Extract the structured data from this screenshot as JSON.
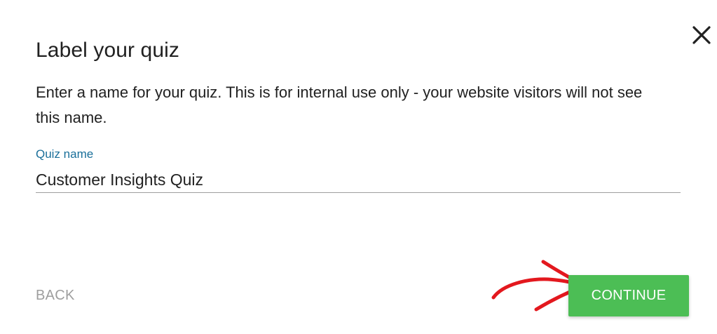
{
  "dialog": {
    "title": "Label your quiz",
    "description": "Enter a name for your quiz. This is for internal use only - your website visitors will not see this name.",
    "field": {
      "label": "Quiz name",
      "value": "Customer Insights Quiz",
      "placeholder": ""
    },
    "footer": {
      "back_label": "BACK",
      "continue_label": "CONTINUE"
    },
    "icons": {
      "close": "close-icon",
      "annotation": "red-arrow-icon"
    }
  },
  "colors": {
    "accent": "#1a6f9a",
    "continue_button": "#4cbe55",
    "annotation_arrow": "#e3181e",
    "back_text": "#9e9e9e",
    "title_text": "#212121"
  }
}
